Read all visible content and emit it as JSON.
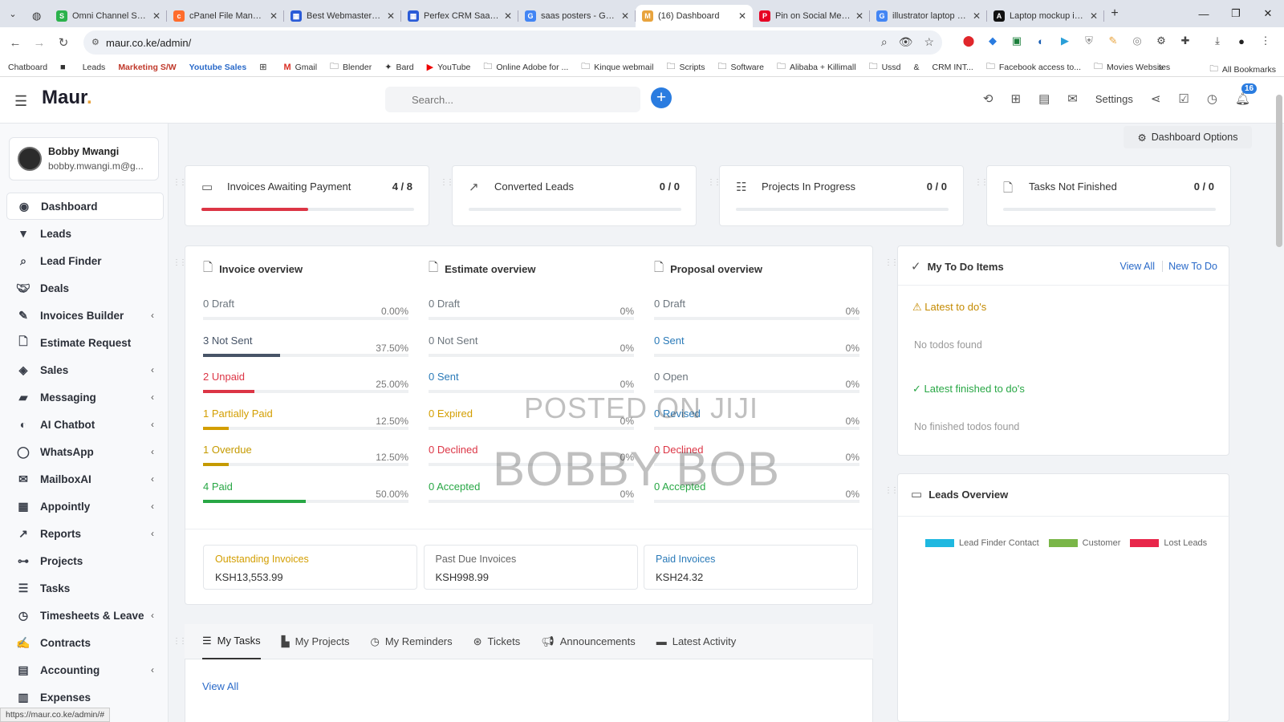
{
  "browser": {
    "tabs": [
      {
        "title": "Omni Channel Sales",
        "favicon": "green-square-icon",
        "color": "#2bb24c"
      },
      {
        "title": "cPanel File Manager",
        "favicon": "cpanel-icon",
        "color": "#ff6c2c"
      },
      {
        "title": "Best Webmaster For",
        "favicon": "grid-square-icon",
        "color": "#2a5bd7"
      },
      {
        "title": "Perfex CRM SaaS Mc",
        "favicon": "grid-square-icon",
        "color": "#2a5bd7"
      },
      {
        "title": "saas posters - Goog",
        "favicon": "google-icon",
        "color": "#4285f4"
      },
      {
        "title": "(16) Dashboard",
        "favicon": "maur-icon",
        "color": "#e8a33d",
        "active": true
      },
      {
        "title": "Pin on Social Media",
        "favicon": "pinterest-icon",
        "color": "#e60023"
      },
      {
        "title": "illustrator laptop mc",
        "favicon": "google-icon",
        "color": "#4285f4"
      },
      {
        "title": "Laptop mockup illus",
        "favicon": "a-icon",
        "color": "#111111"
      }
    ],
    "url": "maur.co.ke/admin/",
    "status_url": "https://maur.co.ke/admin/#",
    "bookmarks": [
      {
        "label": "Chatboard",
        "icon": ""
      },
      {
        "label": "",
        "icon": "square-icon"
      },
      {
        "label": "Leads",
        "icon": ""
      },
      {
        "label": "Marketing S/W",
        "icon": "",
        "color": "#c0392b"
      },
      {
        "label": "Youtube Sales",
        "icon": "",
        "color": "#2a6ac9"
      },
      {
        "label": "",
        "icon": "apps-grid-icon"
      },
      {
        "label": "Gmail",
        "icon": "gmail-icon"
      },
      {
        "label": "Blender",
        "icon": "folder-icon"
      },
      {
        "label": "Bard",
        "icon": "sparkle-icon"
      },
      {
        "label": "YouTube",
        "icon": "youtube-icon"
      },
      {
        "label": "Online Adobe for ...",
        "icon": "folder-icon"
      },
      {
        "label": "Kinque webmail",
        "icon": "folder-icon"
      },
      {
        "label": "Scripts",
        "icon": "folder-icon"
      },
      {
        "label": "Software",
        "icon": "folder-icon"
      },
      {
        "label": "Alibaba + Killimall",
        "icon": "folder-icon"
      },
      {
        "label": "Ussd",
        "icon": "folder-icon"
      },
      {
        "label": "&",
        "icon": ""
      },
      {
        "label": "CRM INT...",
        "icon": ""
      },
      {
        "label": "Facebook access to...",
        "icon": "folder-icon"
      },
      {
        "label": "Movies Websites",
        "icon": "folder-icon"
      }
    ],
    "all_bookmarks": "All Bookmarks"
  },
  "header": {
    "logo": "Maur",
    "logo_dot": ".",
    "search_placeholder": "Search...",
    "settings_label": "Settings",
    "notification_count": "16"
  },
  "sidebar": {
    "user_name": "Bobby Mwangi",
    "user_email": "bobby.mwangi.m@g...",
    "items": [
      {
        "label": "Dashboard",
        "icon": "dashboard-icon",
        "active": true,
        "chevron": false
      },
      {
        "label": "Leads",
        "icon": "filter-icon",
        "chevron": false
      },
      {
        "label": "Lead Finder",
        "icon": "search-icon",
        "chevron": false
      },
      {
        "label": "Deals",
        "icon": "handshake-icon",
        "chevron": false
      },
      {
        "label": "Invoices Builder",
        "icon": "edit-icon",
        "chevron": true
      },
      {
        "label": "Estimate Request",
        "icon": "document-icon",
        "chevron": false
      },
      {
        "label": "Sales",
        "icon": "tags-icon",
        "chevron": true
      },
      {
        "label": "Messaging",
        "icon": "message-icon",
        "chevron": true
      },
      {
        "label": "AI Chatbot",
        "icon": "brain-icon",
        "chevron": true
      },
      {
        "label": "WhatsApp",
        "icon": "whatsapp-icon",
        "chevron": true
      },
      {
        "label": "MailboxAI",
        "icon": "mail-icon",
        "chevron": true
      },
      {
        "label": "Appointly",
        "icon": "calendar-icon",
        "chevron": true
      },
      {
        "label": "Reports",
        "icon": "chart-line-icon",
        "chevron": true
      },
      {
        "label": "Projects",
        "icon": "sitemap-icon",
        "chevron": false
      },
      {
        "label": "Tasks",
        "icon": "task-list-icon",
        "chevron": false
      },
      {
        "label": "Timesheets & Leave",
        "icon": "clock-icon",
        "chevron": true
      },
      {
        "label": "Contracts",
        "icon": "contract-icon",
        "chevron": false
      },
      {
        "label": "Accounting",
        "icon": "calculator-icon",
        "chevron": true
      },
      {
        "label": "Expenses",
        "icon": "receipt-icon",
        "chevron": false
      }
    ]
  },
  "dashboard": {
    "options_label": "Dashboard Options",
    "stats": [
      {
        "label": "Invoices Awaiting Payment",
        "count": "4 / 8",
        "progress": 0.5,
        "color": "#dc3545",
        "icon": "money-icon"
      },
      {
        "label": "Converted Leads",
        "count": "0 / 0",
        "progress": 0,
        "color": "#dc3545",
        "icon": "trend-up-icon"
      },
      {
        "label": "Projects In Progress",
        "count": "0 / 0",
        "progress": 0,
        "color": "#dc3545",
        "icon": "sliders-icon"
      },
      {
        "label": "Tasks Not Finished",
        "count": "0 / 0",
        "progress": 0,
        "color": "#dc3545",
        "icon": "file-check-icon"
      }
    ],
    "invoice_overview": {
      "title": "Invoice overview",
      "rows": [
        {
          "label": "0 Draft",
          "percent": "0.00%",
          "value": 0,
          "color": "#6c757d"
        },
        {
          "label": "3 Not Sent",
          "percent": "37.50%",
          "value": 37.5,
          "color": "#475467"
        },
        {
          "label": "2 Unpaid",
          "percent": "25.00%",
          "value": 25,
          "color": "#dc3545"
        },
        {
          "label": "1 Partially Paid",
          "percent": "12.50%",
          "value": 12.5,
          "color": "#d39e00"
        },
        {
          "label": "1 Overdue",
          "percent": "12.50%",
          "value": 12.5,
          "color": "#c59a00"
        },
        {
          "label": "4 Paid",
          "percent": "50.00%",
          "value": 50,
          "color": "#28a745"
        }
      ]
    },
    "estimate_overview": {
      "title": "Estimate overview",
      "rows": [
        {
          "label": "0 Draft",
          "percent": "0%",
          "value": 0,
          "color": "#6c757d"
        },
        {
          "label": "0 Not Sent",
          "percent": "0%",
          "value": 0,
          "color": "#6c757d"
        },
        {
          "label": "0 Sent",
          "percent": "0%",
          "value": 0,
          "color": "#2a7ab8"
        },
        {
          "label": "0 Expired",
          "percent": "0%",
          "value": 0,
          "color": "#d39e00"
        },
        {
          "label": "0 Declined",
          "percent": "0%",
          "value": 0,
          "color": "#dc3545"
        },
        {
          "label": "0 Accepted",
          "percent": "0%",
          "value": 0,
          "color": "#28a745"
        }
      ]
    },
    "proposal_overview": {
      "title": "Proposal overview",
      "rows": [
        {
          "label": "0 Draft",
          "percent": "0%",
          "value": 0,
          "color": "#6c757d"
        },
        {
          "label": "0 Sent",
          "percent": "0%",
          "value": 0,
          "color": "#2a7ab8"
        },
        {
          "label": "0 Open",
          "percent": "0%",
          "value": 0,
          "color": "#6c757d"
        },
        {
          "label": "0 Revised",
          "percent": "0%",
          "value": 0,
          "color": "#2a7ab8"
        },
        {
          "label": "0 Declined",
          "percent": "0%",
          "value": 0,
          "color": "#dc3545"
        },
        {
          "label": "0 Accepted",
          "percent": "0%",
          "value": 0,
          "color": "#28a745"
        }
      ]
    },
    "summary": [
      {
        "label": "Outstanding Invoices",
        "value": "KSH13,553.99",
        "color": "#d39e00"
      },
      {
        "label": "Past Due Invoices",
        "value": "KSH998.99",
        "color": "#666666"
      },
      {
        "label": "Paid Invoices",
        "value": "KSH24.32",
        "color": "#2a7ab8"
      }
    ],
    "todo": {
      "title": "My To Do Items",
      "view_all": "View All",
      "new_todo": "New To Do",
      "latest_label": "Latest to do's",
      "latest_empty": "No todos found",
      "finished_label": "Latest finished to do's",
      "finished_empty": "No finished todos found"
    },
    "leads_overview": {
      "title": "Leads Overview",
      "legend": [
        {
          "label": "Lead Finder Contact",
          "color": "#1fb8e0"
        },
        {
          "label": "Customer",
          "color": "#7ab648"
        },
        {
          "label": "Lost Leads",
          "color": "#e8264a"
        }
      ]
    },
    "bottom_tabs": [
      {
        "label": "My Tasks",
        "icon": "task-list-icon",
        "active": true
      },
      {
        "label": "My Projects",
        "icon": "chart-bar-icon"
      },
      {
        "label": "My Reminders",
        "icon": "clock-icon"
      },
      {
        "label": "Tickets",
        "icon": "lifebuoy-icon"
      },
      {
        "label": "Announcements",
        "icon": "megaphone-icon"
      },
      {
        "label": "Latest Activity",
        "icon": "window-icon"
      }
    ],
    "tasks_view_all": "View All"
  },
  "watermark": {
    "line1": "POSTED ON JIJI",
    "line2": "BOBBY BOB"
  }
}
